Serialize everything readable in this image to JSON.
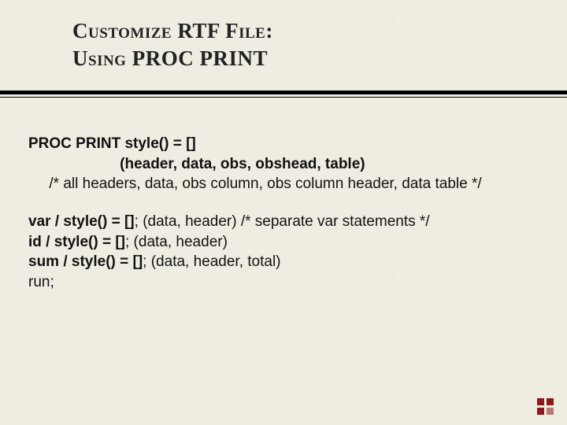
{
  "title": {
    "line1": "Customize RTF File:",
    "line2": "Using PROC PRINT"
  },
  "body": {
    "proc_label": "PROC PRINT",
    "proc_style": "  style() = []",
    "proc_args": "                      (header, data, obs, obshead, table)",
    "proc_comment": "     /* all headers, data, obs column, obs column header, data table */",
    "var_stmt": "  var / style() = []",
    "var_args": ";  (data, header)",
    "var_comment": "           /* separate var statements */",
    "id_stmt": "  id / style() = []",
    "id_args": ";  (data, header)",
    "sum_stmt": "  sum / style() = []",
    "sum_args": ";  (data, header, total)",
    "run": "run;"
  },
  "accent_color": "#8a1a1a"
}
